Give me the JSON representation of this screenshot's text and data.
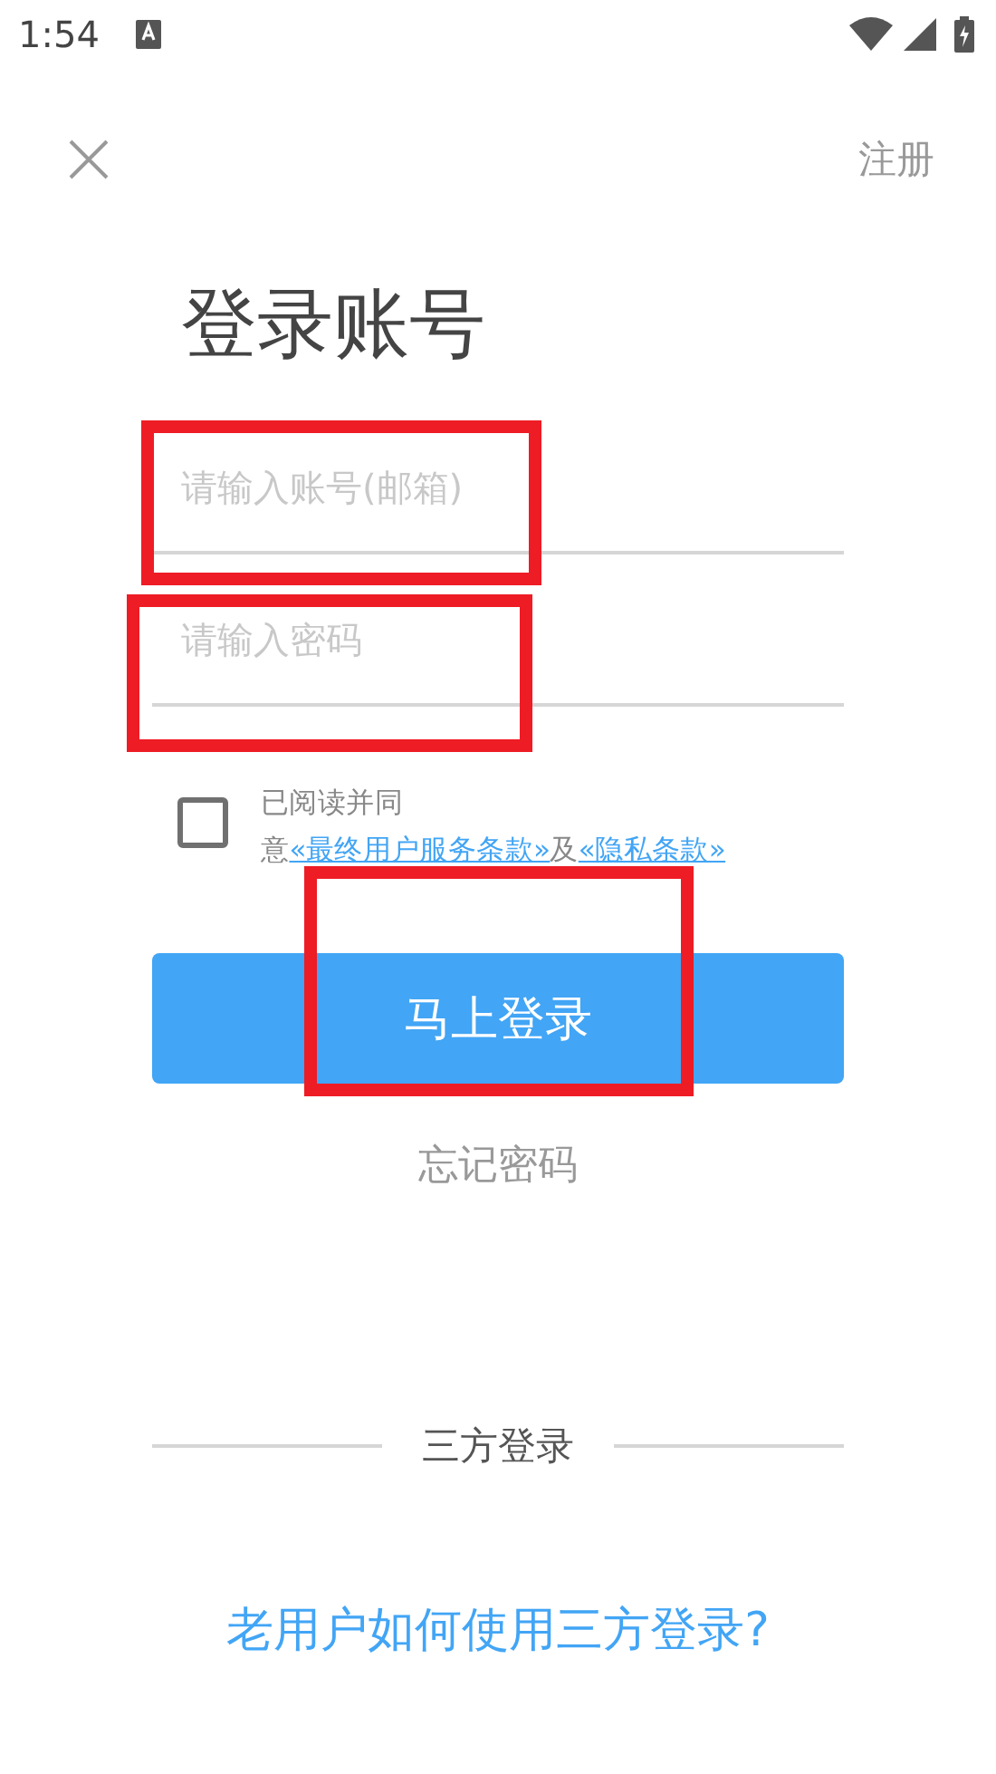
{
  "status_bar": {
    "time": "1:54"
  },
  "header": {
    "register": "注册"
  },
  "title": "登录账号",
  "fields": [
    {
      "placeholder": "请输入账号(邮箱)",
      "highlighted": true
    },
    {
      "placeholder": "请输入密码",
      "highlighted": true
    }
  ],
  "agreement": {
    "checked": false,
    "parts": [
      {
        "kind": "text",
        "text": "已阅读并同意"
      },
      {
        "kind": "link",
        "text": "«最终用户服务条款»"
      },
      {
        "kind": "text",
        "text": "及"
      },
      {
        "kind": "link",
        "text": "«隐私条款»"
      }
    ]
  },
  "login_button": {
    "label": "马上登录",
    "highlighted": true
  },
  "forgot_password": "忘记密码",
  "third_party": {
    "label": "三方登录",
    "help_link": "老用户如何使用三方登录?"
  }
}
